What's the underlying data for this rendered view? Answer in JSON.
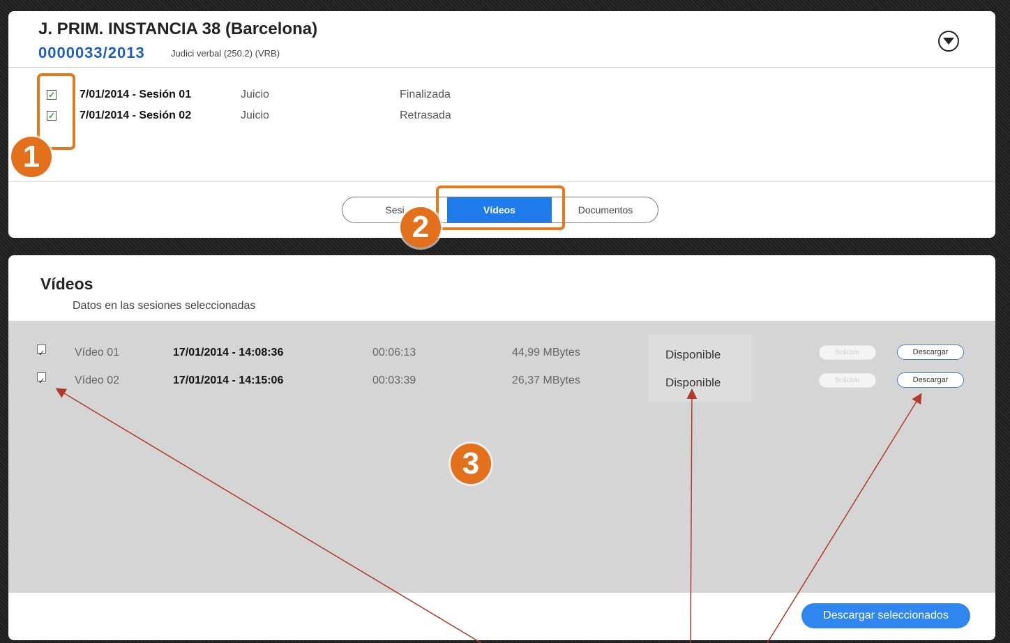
{
  "header": {
    "court": "J. PRIM. INSTANCIA 38 (Barcelona)",
    "case_number": "0000033/2013",
    "case_type": "Judici verbal (250.2) (VRB)",
    "dropdown_icon": "chevron-down-circle-icon"
  },
  "sessions": [
    {
      "checked": true,
      "date": "7/01/2014 - Sesión 01",
      "type": "Juicio",
      "status": "Finalizada"
    },
    {
      "checked": true,
      "date": "7/01/2014 - Sesión 02",
      "type": "Juicio",
      "status": "Retrasada"
    }
  ],
  "tabs": {
    "sesiones": "Sesi",
    "videos": "Vídeos",
    "documentos": "Documentos",
    "active": "videos"
  },
  "callouts": [
    "1",
    "2",
    "3"
  ],
  "videos_panel": {
    "title": "Vídeos",
    "subtitle": "Datos en las sesiones seleccionadas",
    "rows": [
      {
        "checked": true,
        "name": "Vídeo 01",
        "datetime": "17/01/2014 - 14:08:36",
        "duration": "00:06:13",
        "size": "44,99 MBytes",
        "status": "Disponible",
        "request_label": "Solicitar",
        "download_label": "Descargar"
      },
      {
        "checked": true,
        "name": "Vídeo 02",
        "datetime": "17/01/2014 - 14:15:06",
        "duration": "00:03:39",
        "size": "26,37 MBytes",
        "status": "Disponible",
        "request_label": "Solicitar",
        "download_label": "Descargar"
      }
    ],
    "bulk_download_label": "Descargar seleccionados"
  },
  "colors": {
    "accent": "#1f7bea",
    "callout": "#e3701a",
    "case_number": "#1f5fb8",
    "annotation_arrow": "#b03a2e"
  }
}
